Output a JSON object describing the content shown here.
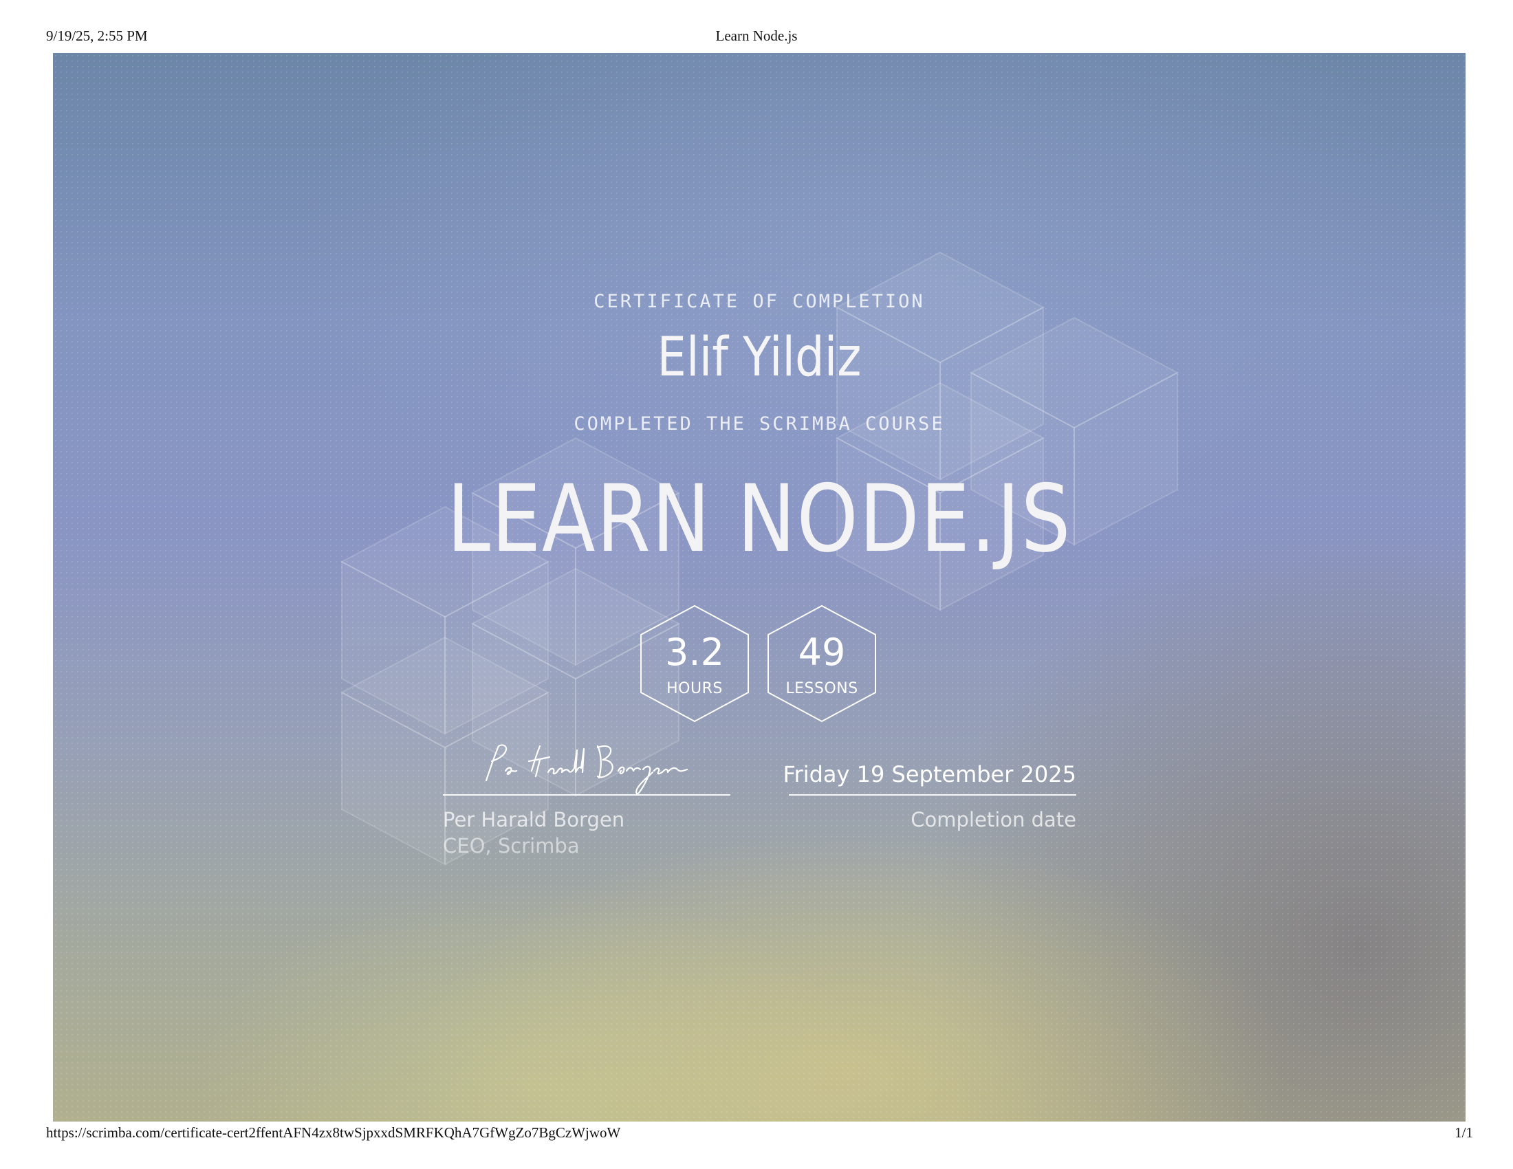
{
  "print_header": {
    "datetime": "9/19/25, 2:55 PM",
    "page_title": "Learn Node.js"
  },
  "print_footer": {
    "url": "https://scrimba.com/certificate-cert2ffentAFN4zx8twSjpxxdSMRFKQhA7GfWgZo7BgCzWjwoW",
    "page_number": "1/1"
  },
  "certificate": {
    "heading": "CERTIFICATE OF COMPLETION",
    "recipient_name": "Elif Yildiz",
    "completed_text": "COMPLETED THE SCRIMBA COURSE",
    "course_title": "LEARN NODE.JS",
    "stats": {
      "hours_value": "3.2",
      "hours_label": "HOURS",
      "lessons_value": "49",
      "lessons_label": "LESSONS"
    },
    "signer": {
      "name": "Per Harald Borgen",
      "title": "CEO, Scrimba"
    },
    "completion": {
      "date": "Friday 19 September 2025",
      "label": "Completion date"
    }
  }
}
